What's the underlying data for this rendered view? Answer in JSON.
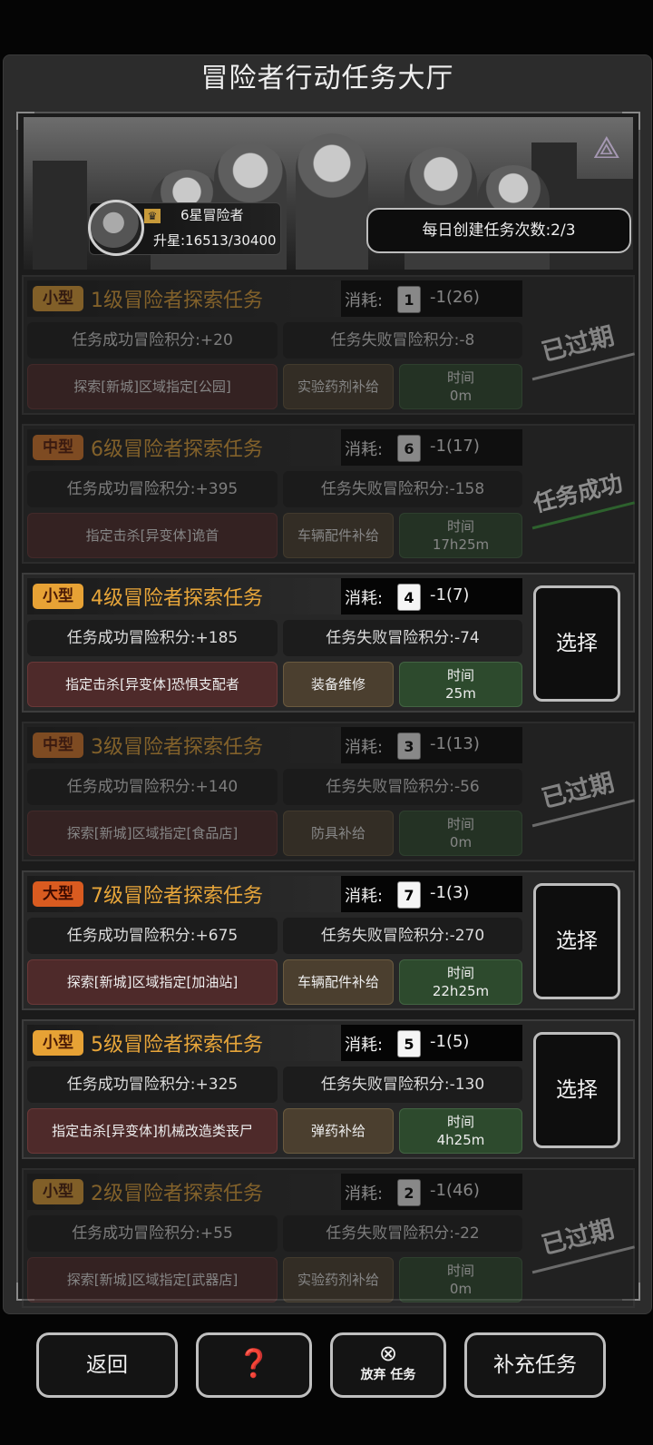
{
  "header": {
    "title": "冒险者行动任务大厅"
  },
  "profile": {
    "rank": "6星冒险者",
    "stars": "升星:16513/30400",
    "crown_icon": "crown-icon"
  },
  "daily": {
    "label": "每日创建任务次数:2/3"
  },
  "cost_label": "消耗:",
  "select_label": "选择",
  "tasks": [
    {
      "size": "小型",
      "name": "1级冒险者探索任务",
      "lv": "1",
      "cost": "-1(26)",
      "success": "任务成功冒险积分:+20",
      "fail": "任务失败冒险积分:-8",
      "target": "探索[新城]区域指定[公园]",
      "supply": "实验药剂补给",
      "time_label": "时间",
      "time": "0m",
      "status": "已过期"
    },
    {
      "size": "中型",
      "name": "6级冒险者探索任务",
      "lv": "6",
      "cost": "-1(17)",
      "success": "任务成功冒险积分:+395",
      "fail": "任务失败冒险积分:-158",
      "target": "指定击杀[异变体]诡首",
      "supply": "车辆配件补给",
      "time_label": "时间",
      "time": "17h25m",
      "status": "任务成功"
    },
    {
      "size": "小型",
      "name": "4级冒险者探索任务",
      "lv": "4",
      "cost": "-1(7)",
      "success": "任务成功冒险积分:+185",
      "fail": "任务失败冒险积分:-74",
      "target": "指定击杀[异变体]恐惧支配者",
      "supply": "装备维修",
      "time_label": "时间",
      "time": "25m",
      "status": ""
    },
    {
      "size": "中型",
      "name": "3级冒险者探索任务",
      "lv": "3",
      "cost": "-1(13)",
      "success": "任务成功冒险积分:+140",
      "fail": "任务失败冒险积分:-56",
      "target": "探索[新城]区域指定[食品店]",
      "supply": "防具补给",
      "time_label": "时间",
      "time": "0m",
      "status": "已过期"
    },
    {
      "size": "大型",
      "name": "7级冒险者探索任务",
      "lv": "7",
      "cost": "-1(3)",
      "success": "任务成功冒险积分:+675",
      "fail": "任务失败冒险积分:-270",
      "target": "探索[新城]区域指定[加油站]",
      "supply": "车辆配件补给",
      "time_label": "时间",
      "time": "22h25m",
      "status": ""
    },
    {
      "size": "小型",
      "name": "5级冒险者探索任务",
      "lv": "5",
      "cost": "-1(5)",
      "success": "任务成功冒险积分:+325",
      "fail": "任务失败冒险积分:-130",
      "target": "指定击杀[异变体]机械改造类丧尸",
      "supply": "弹药补给",
      "time_label": "时间",
      "time": "4h25m",
      "status": ""
    },
    {
      "size": "小型",
      "name": "2级冒险者探索任务",
      "lv": "2",
      "cost": "-1(46)",
      "success": "任务成功冒险积分:+55",
      "fail": "任务失败冒险积分:-22",
      "target": "探索[新城]区域指定[武器店]",
      "supply": "实验药剂补给",
      "time_label": "时间",
      "time": "0m",
      "status": "已过期"
    }
  ],
  "footer": {
    "back": "返回",
    "help_icon": "question-map-icon",
    "abandon_icon": "close-circle-icon",
    "abandon": "放弃 任务",
    "add": "补充任务"
  }
}
